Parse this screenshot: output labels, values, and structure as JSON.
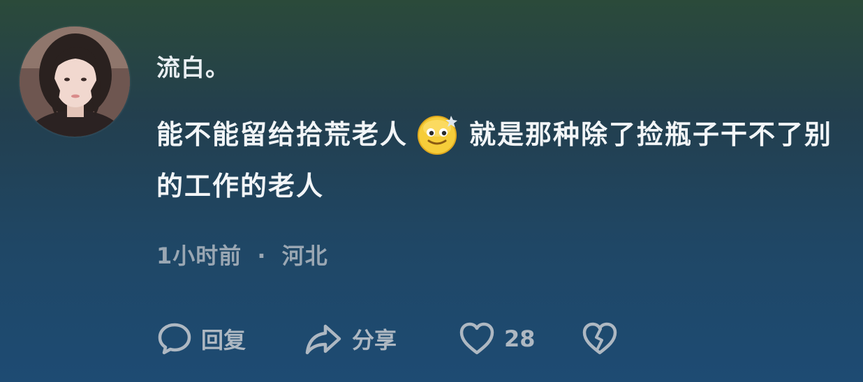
{
  "comment": {
    "username": "流白。",
    "text_before_emoji": "能不能留给拾荒老人",
    "emoji": "smug-face-emoji",
    "text_after_emoji": "就是那种除了捡瓶子干不了别的工作的老人",
    "time": "1小时前",
    "separator": "·",
    "location": "河北"
  },
  "actions": {
    "reply_label": "回复",
    "share_label": "分享",
    "like_count": "28"
  },
  "icons": {
    "reply": "comment-bubble-icon",
    "share": "share-arrow-icon",
    "like": "heart-icon",
    "dislike": "broken-heart-icon"
  },
  "colors": {
    "text_primary": "#f2f5f7",
    "text_secondary": "#9aa7b3",
    "icon": "#aeb8c2"
  }
}
